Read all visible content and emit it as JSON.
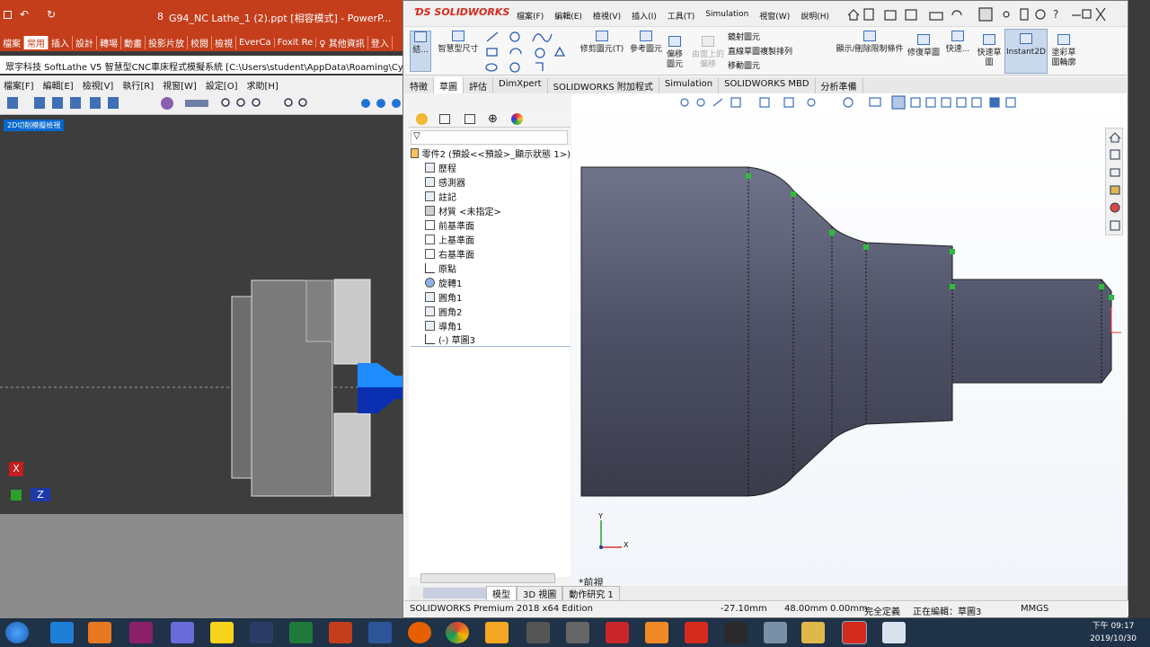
{
  "ppt": {
    "title": "G94_NC Lathe_1 (2).ppt [相容模式] - PowerP...",
    "slide_num": "8",
    "tabs": [
      "檔案",
      "常用",
      "插入",
      "設計",
      "轉場",
      "動畫",
      "投影片放",
      "校閱",
      "檢視",
      "EverCa",
      "Foxit Re",
      "♀ 其他資訊",
      "登入"
    ]
  },
  "softlathe": {
    "title": "眾宇科技 SoftLathe V5 智慧型CNC車床程式模擬系統 [C:\\Users\\student\\AppData\\Roaming\\Cytek",
    "menu": [
      "檔案[F]",
      "編輯[E]",
      "檢視[V]",
      "執行[R]",
      "視窗[W]",
      "設定[O]",
      "求助[H]"
    ],
    "tag": "2D切削模擬檢視",
    "axis_x": "X",
    "axis_z": "Z"
  },
  "sw": {
    "logo": "SOLIDWORKS",
    "menu": [
      "檔案(F)",
      "編輯(E)",
      "檢視(V)",
      "插入(I)",
      "工具(T)",
      "Simulation",
      "視窗(W)",
      "說明(H)"
    ],
    "cmd": {
      "exit_sketch": "結...",
      "smart_dim": "智慧型尺寸",
      "trim": "修剪圖元(T)",
      "convert": "參考圖元",
      "offset": "偏移圖元",
      "offset_surface": "由面上的偏移",
      "mirror": "鏡射圖元",
      "linear_pattern": "直線草圖複製排列",
      "move": "移動圖元",
      "display_rel": "顯示/刪除限制條件",
      "repair": "修復草圖",
      "quick_snaps": "快速...",
      "rapid_sketch": "快速草圖",
      "instant2d": "Instant2D",
      "shaded_sketch": "塗彩草圖輪廓"
    },
    "tabs": [
      "特徵",
      "草圖",
      "評估",
      "DimXpert",
      "SOLIDWORKS 附加程式",
      "Simulation",
      "SOLIDWORKS MBD",
      "分析準備"
    ],
    "active_tab": "草圖",
    "tree": [
      {
        "label": "零件2 (預設<<預設>_顯示狀態 1>)",
        "icon": "part-icon"
      },
      {
        "label": "歷程",
        "icon": "history-icon"
      },
      {
        "label": "感測器",
        "icon": "sensor-icon"
      },
      {
        "label": "註記",
        "icon": "annotation-icon"
      },
      {
        "label": "材質 <未指定>",
        "icon": "material-icon"
      },
      {
        "label": "前基準面",
        "icon": "plane-icon"
      },
      {
        "label": "上基準面",
        "icon": "plane-icon"
      },
      {
        "label": "右基準面",
        "icon": "plane-icon"
      },
      {
        "label": "原點",
        "icon": "origin-icon"
      },
      {
        "label": "旋轉1",
        "icon": "revolve-icon"
      },
      {
        "label": "圓角1",
        "icon": "fillet-icon"
      },
      {
        "label": "圓角2",
        "icon": "fillet-icon"
      },
      {
        "label": "導角1",
        "icon": "chamfer-icon"
      },
      {
        "label": "(-) 草圖3",
        "icon": "sketch-icon"
      }
    ],
    "view_label": "*前視",
    "bottom_tabs": [
      "模型",
      "3D 視圖",
      "動作研究 1"
    ],
    "status": {
      "edition": "SOLIDWORKS Premium 2018 x64 Edition",
      "x": "-27.10mm",
      "y": "48.00mm",
      "z": "0.00mm",
      "state": "完全定義",
      "editing": "正在編輯：草圖3",
      "units": "MMGS"
    },
    "triad": {
      "y": "Y",
      "x": "X"
    }
  },
  "taskbar": {
    "time": "下午 09:17",
    "date": "2019/10/30"
  }
}
